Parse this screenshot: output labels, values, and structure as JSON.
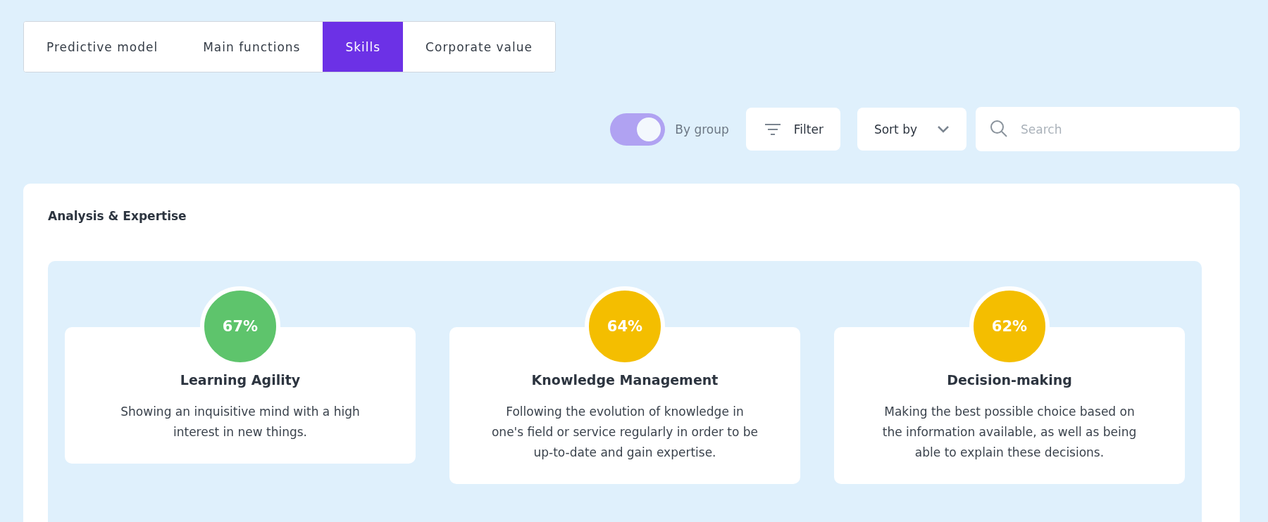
{
  "tabs": [
    {
      "label": "Predictive model",
      "selected": false
    },
    {
      "label": "Main functions",
      "selected": false
    },
    {
      "label": "Skills",
      "selected": true
    },
    {
      "label": "Corporate value",
      "selected": false
    }
  ],
  "toolbar": {
    "group_toggle": {
      "label": "By group",
      "on": true
    },
    "filter": {
      "label": "Filter"
    },
    "sort": {
      "label": "Sort by"
    },
    "search": {
      "placeholder": "Search"
    }
  },
  "group": {
    "title": "Analysis & Expertise",
    "skills": [
      {
        "score": "67%",
        "color": "#5ec46c",
        "name": "Learning Agility",
        "description": "Showing an inquisitive mind with a high interest in new things."
      },
      {
        "score": "64%",
        "color": "#f4be00",
        "name": "Knowledge Management",
        "description": "Following the evolution of knowledge in one's field or service regularly in order to be up-to-date and gain expertise."
      },
      {
        "score": "62%",
        "color": "#f4be00",
        "name": "Decision-making",
        "description": "Making the best possible choice based on the information available, as well as being able to explain these decisions."
      }
    ]
  }
}
